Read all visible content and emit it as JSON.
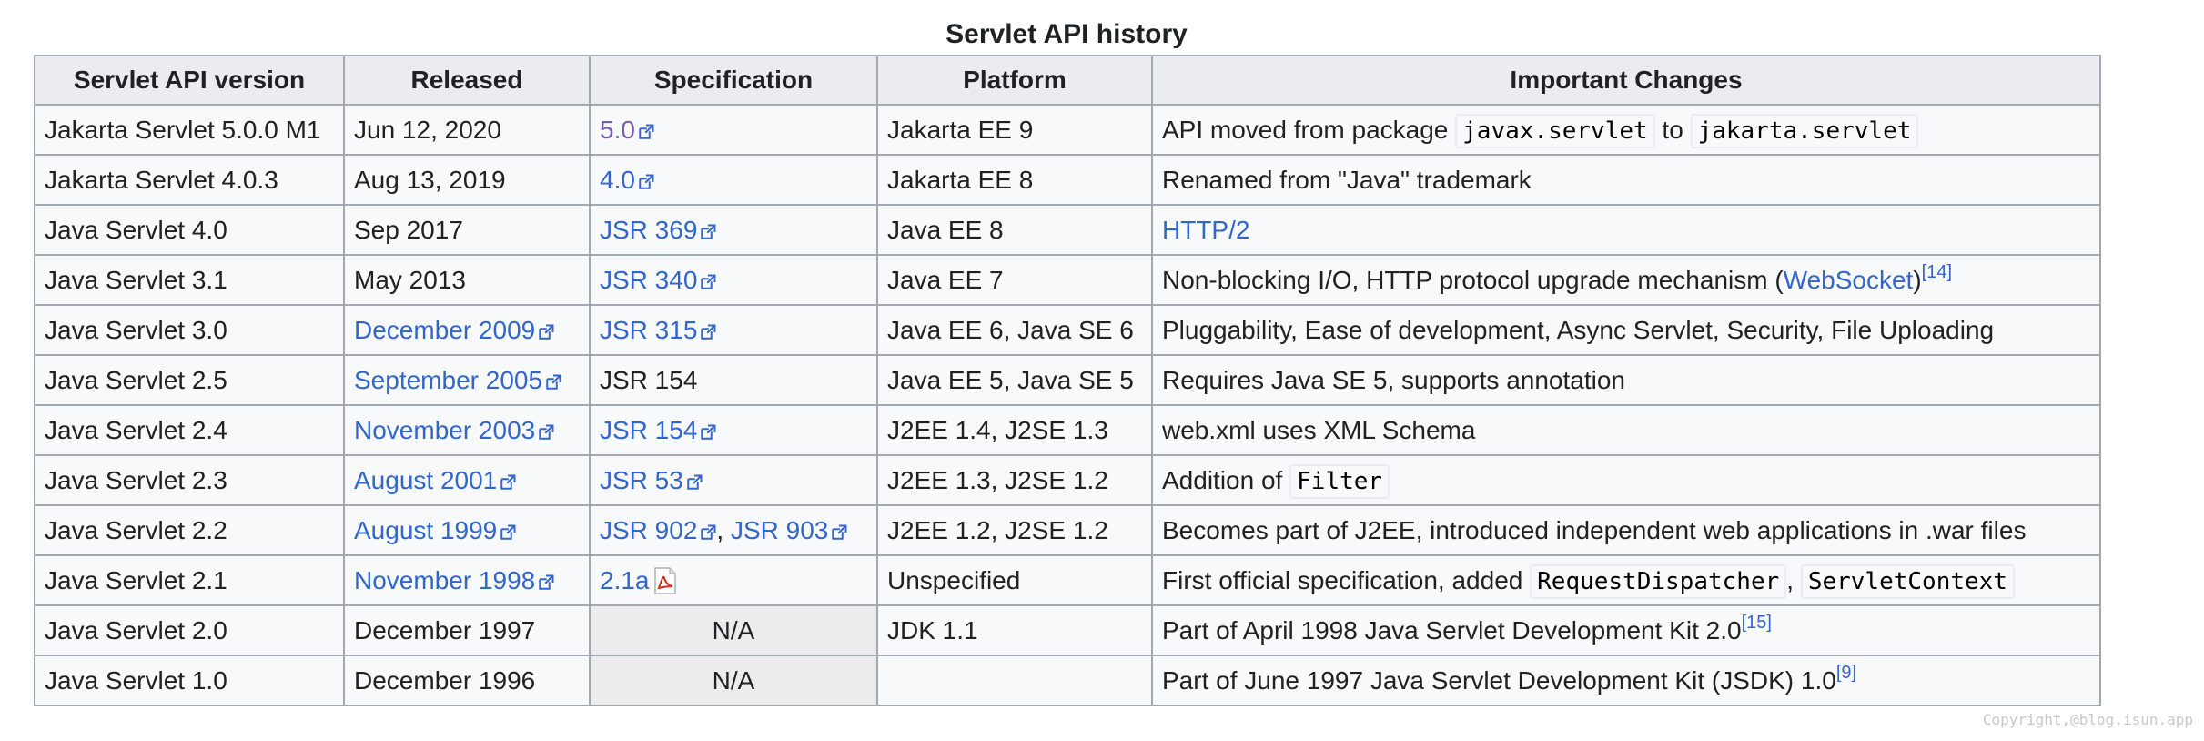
{
  "caption": "Servlet API history",
  "headers": [
    "Servlet API version",
    "Released",
    "Specification",
    "Platform",
    "Important Changes"
  ],
  "rows": [
    {
      "version": "Jakarta Servlet 5.0.0 M1",
      "released": "Jun 12, 2020",
      "released_link": false,
      "spec": [
        {
          "text": "5.0",
          "link": true,
          "visited": true,
          "ext": true
        }
      ],
      "platform": "Jakarta EE 9",
      "changes": [
        {
          "t": "text",
          "v": "API moved from package "
        },
        {
          "t": "code",
          "v": "javax.servlet"
        },
        {
          "t": "text",
          "v": " to "
        },
        {
          "t": "code",
          "v": "jakarta.servlet"
        }
      ]
    },
    {
      "version": "Jakarta Servlet 4.0.3",
      "released": "Aug 13, 2019",
      "released_link": false,
      "spec": [
        {
          "text": "4.0",
          "link": true,
          "ext": true
        }
      ],
      "platform": "Jakarta EE 8",
      "changes": [
        {
          "t": "text",
          "v": "Renamed from \"Java\" trademark"
        }
      ]
    },
    {
      "version": "Java Servlet 4.0",
      "released": "Sep 2017",
      "released_link": false,
      "spec": [
        {
          "text": "JSR 369",
          "link": true,
          "ext": true
        }
      ],
      "platform": "Java EE 8",
      "changes": [
        {
          "t": "link",
          "v": "HTTP/2"
        }
      ]
    },
    {
      "version": "Java Servlet 3.1",
      "released": "May 2013",
      "released_link": false,
      "spec": [
        {
          "text": "JSR 340",
          "link": true,
          "ext": true
        }
      ],
      "platform": "Java EE 7",
      "changes": [
        {
          "t": "text",
          "v": "Non-blocking I/O, HTTP protocol upgrade mechanism ("
        },
        {
          "t": "link",
          "v": "WebSocket"
        },
        {
          "t": "text",
          "v": ")"
        },
        {
          "t": "sup",
          "v": "[14]"
        }
      ]
    },
    {
      "version": "Java Servlet 3.0",
      "released": "December 2009",
      "released_link": true,
      "spec": [
        {
          "text": "JSR 315",
          "link": true,
          "ext": true
        }
      ],
      "platform": "Java EE 6, Java SE 6",
      "changes": [
        {
          "t": "text",
          "v": "Pluggability, Ease of development, Async Servlet, Security, File Uploading"
        }
      ]
    },
    {
      "version": "Java Servlet 2.5",
      "released": "September 2005",
      "released_link": true,
      "spec": [
        {
          "text": "JSR 154",
          "link": false
        }
      ],
      "platform": "Java EE 5, Java SE 5",
      "changes": [
        {
          "t": "text",
          "v": "Requires Java SE 5, supports annotation"
        }
      ]
    },
    {
      "version": "Java Servlet 2.4",
      "released": "November 2003",
      "released_link": true,
      "spec": [
        {
          "text": "JSR 154",
          "link": true,
          "ext": true
        }
      ],
      "platform": "J2EE 1.4, J2SE 1.3",
      "changes": [
        {
          "t": "text",
          "v": "web.xml uses XML Schema"
        }
      ]
    },
    {
      "version": "Java Servlet 2.3",
      "released": "August 2001",
      "released_link": true,
      "spec": [
        {
          "text": "JSR 53",
          "link": true,
          "ext": true
        }
      ],
      "platform": "J2EE 1.3, J2SE 1.2",
      "changes": [
        {
          "t": "text",
          "v": "Addition of "
        },
        {
          "t": "code",
          "v": "Filter"
        }
      ]
    },
    {
      "version": "Java Servlet 2.2",
      "released": "August 1999",
      "released_link": true,
      "spec": [
        {
          "text": "JSR 902",
          "link": true,
          "ext": true
        },
        {
          "text": ", ",
          "link": false
        },
        {
          "text": "JSR 903",
          "link": true,
          "ext": true
        }
      ],
      "platform": "J2EE 1.2, J2SE 1.2",
      "changes": [
        {
          "t": "text",
          "v": "Becomes part of J2EE, introduced independent web applications in .war files"
        }
      ]
    },
    {
      "version": "Java Servlet 2.1",
      "released": "November 1998",
      "released_link": true,
      "spec": [
        {
          "text": "2.1a",
          "link": true,
          "pdf": true
        }
      ],
      "platform": "Unspecified",
      "changes": [
        {
          "t": "text",
          "v": "First official specification, added "
        },
        {
          "t": "code",
          "v": "RequestDispatcher"
        },
        {
          "t": "text",
          "v": ", "
        },
        {
          "t": "code",
          "v": "ServletContext"
        }
      ]
    },
    {
      "version": "Java Servlet 2.0",
      "released": "December 1997",
      "released_link": false,
      "spec": [
        {
          "text": "N/A",
          "na": true
        }
      ],
      "platform": "JDK 1.1",
      "changes": [
        {
          "t": "text",
          "v": "Part of April 1998 Java Servlet Development Kit 2.0"
        },
        {
          "t": "sup",
          "v": "[15]"
        }
      ]
    },
    {
      "version": "Java Servlet 1.0",
      "released": "December 1996",
      "released_link": false,
      "spec": [
        {
          "text": "N/A",
          "na": true
        }
      ],
      "platform": "",
      "changes": [
        {
          "t": "text",
          "v": "Part of June 1997 Java Servlet Development Kit (JSDK) 1.0"
        },
        {
          "t": "sup",
          "v": "[9]"
        }
      ]
    }
  ],
  "watermark": "Copyright,@blog.isun.app",
  "colors": {
    "link": "#3366cc",
    "visited": "#795cb2",
    "header_bg": "#eaecf0",
    "cell_bg": "#f8f9fa",
    "border": "#a2a9b1"
  }
}
